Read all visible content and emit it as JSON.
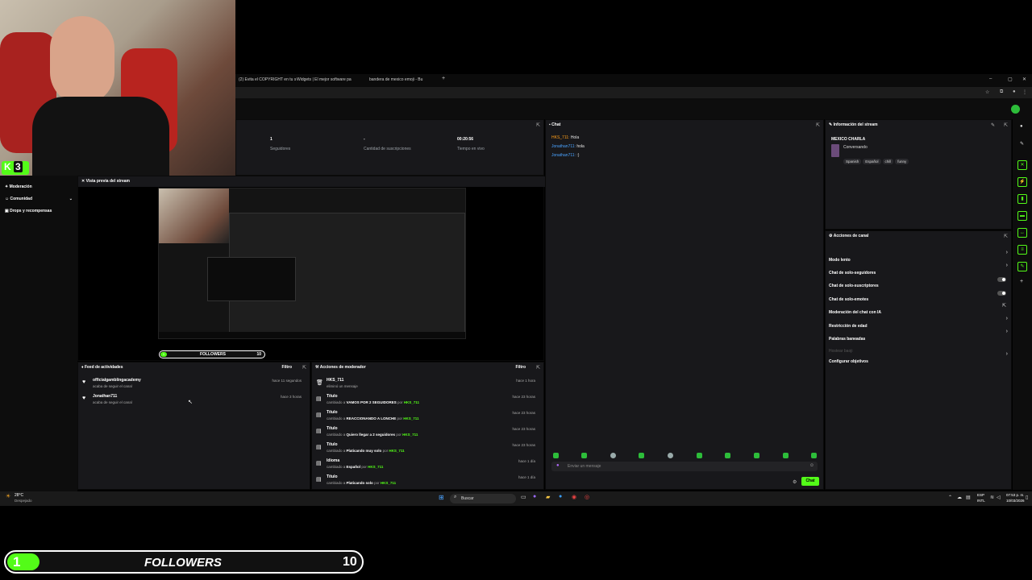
{
  "browser": {
    "tabs": [
      "(2) Evita el COPYRIGHT en tu s",
      "Widgets | El mejor software pa",
      "bandera de mexico emoji - Bu"
    ],
    "new_tab": "+",
    "window_controls": [
      "–",
      "▢",
      "✕"
    ]
  },
  "webcam_overlay": {
    "badge": "3"
  },
  "sidebar": {
    "items": [
      {
        "label": "Moderación",
        "icon": "shield-icon"
      },
      {
        "label": "Comunidad",
        "icon": "people-icon"
      },
      {
        "label": "Drops y recompensas",
        "icon": "gift-icon"
      }
    ]
  },
  "stats": {
    "followers_value": "1",
    "followers_label": "Seguidores",
    "subs_value": "-",
    "subs_label": "Cantidad de suscripciones",
    "live_value": "00:20:56",
    "live_label": "Tiempo en vivo"
  },
  "preview": {
    "title": "Vista previa del stream",
    "followers_widget": {
      "left": "1",
      "label": "FOLLOWERS",
      "right": "10"
    }
  },
  "chat": {
    "title": "Chat",
    "messages": [
      {
        "user": "HKS_711:",
        "text": "Hola",
        "user_color": "#ff9f1a"
      },
      {
        "user": "Jonathan711:",
        "text": "hola",
        "user_color": "#4aa3ff"
      },
      {
        "user": "Jonathan711:",
        "text": ":)",
        "user_color": "#4aa3ff"
      }
    ],
    "input_placeholder": "Enviar un mensaje",
    "send_label": "Chat"
  },
  "stream_info": {
    "title": "Información del stream",
    "stream_title": "MEXICO CHARLA",
    "category": "Conversando",
    "tags": [
      "Spanish",
      "Español",
      "chill",
      "funny"
    ]
  },
  "channel_actions": {
    "title": "Acciones de canal",
    "items": [
      {
        "label": "Modo lento",
        "control": "chevron"
      },
      {
        "label": "Chat de solo-seguidores",
        "control": "chevron"
      },
      {
        "label": "Chat de solo-suscriptores",
        "control": "toggle"
      },
      {
        "label": "Chat de solo-emotes",
        "control": "toggle"
      },
      {
        "label": "Moderación del chat con IA",
        "control": "open"
      },
      {
        "label": "Restricción de edad",
        "control": "chevron"
      },
      {
        "label": "Palabras baneadas",
        "control": "chevron"
      },
      {
        "label": "Hostear baoji",
        "control": "none"
      },
      {
        "label": "Configurar objetivos",
        "control": "chevron"
      }
    ]
  },
  "activity_feed": {
    "title": "Feed de actividades",
    "filter": "Filtro",
    "items": [
      {
        "user": "officialgamblingacademy",
        "action": "acaba de seguir el canal",
        "time": "hace 11 segundos"
      },
      {
        "user": "Jonathan711",
        "action": "acaba de seguir el canal",
        "time": "hace 3 horas"
      }
    ]
  },
  "mod_actions": {
    "title": "Acciones de moderador",
    "filter": "Filtro",
    "items": [
      {
        "title": "HKS_711",
        "pre": "eliminó un mensaje",
        "value": "",
        "by": "",
        "user": "",
        "time": "hace 1 hora"
      },
      {
        "title": "Título",
        "pre": "cambiado a",
        "value": "VAMOS POR 2 SEGUIDORES",
        "by": "por",
        "user": "HKS_711",
        "time": "hace 23 horas"
      },
      {
        "title": "Título",
        "pre": "cambiado a",
        "value": "REACCIONANDO A LONCHE",
        "by": "por",
        "user": "HKS_711",
        "time": "hace 23 horas"
      },
      {
        "title": "Título",
        "pre": "cambiado a",
        "value": "Quiero llegar a 2 seguidores",
        "by": "por",
        "user": "HKS_711",
        "time": "hace 23 horas"
      },
      {
        "title": "Título",
        "pre": "cambiado a",
        "value": "Platicando muy solo",
        "by": "por",
        "user": "HKS_711",
        "time": "hace 23 horas"
      },
      {
        "title": "Idioma",
        "pre": "cambiado a",
        "value": "Español",
        "by": "por",
        "user": "HKS_711",
        "time": "hace 1 día"
      },
      {
        "title": "Título",
        "pre": "cambiado a",
        "value": "Platicando solo",
        "by": "por",
        "user": "HKS_711",
        "time": "hace 1 día"
      }
    ]
  },
  "taskbar": {
    "weather_temp": "28°C",
    "weather_desc": "Despejado",
    "search_placeholder": "Buscar",
    "lang": "ESP",
    "lang2": "INTL",
    "time": "07:53 p. m.",
    "date": "10/03/2026"
  },
  "followers_overlay": {
    "left": "1",
    "label": "FOLLOWERS",
    "right": "10"
  },
  "colors": {
    "accent": "#53fc18",
    "panel": "#18181b",
    "bg": "#000000"
  }
}
